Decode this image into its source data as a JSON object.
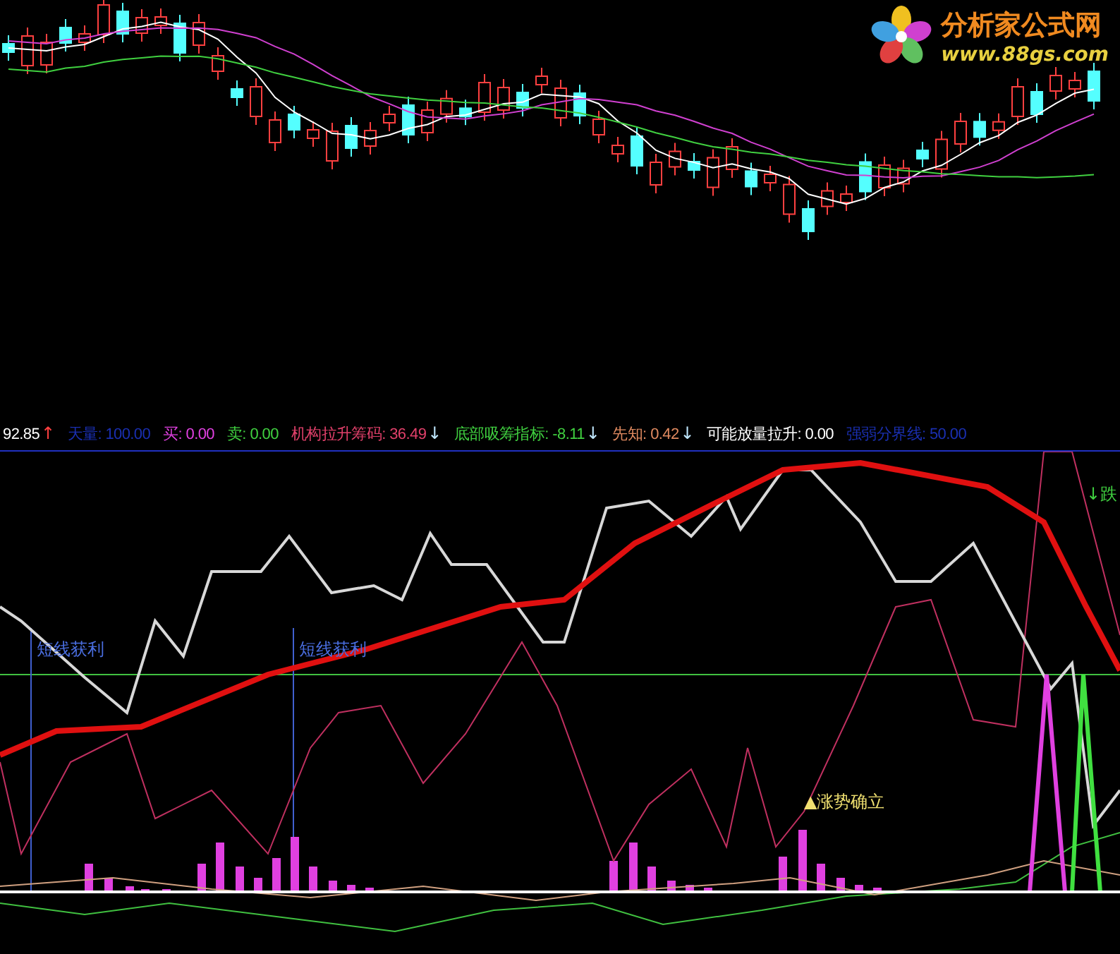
{
  "logo": {
    "name": "分析家公式网",
    "url": "www.88gs.com"
  },
  "indicator_bar": {
    "items": [
      {
        "text": "92.85",
        "arrow": "↑",
        "color": "#ffffff"
      },
      {
        "text": "天量: 100.00",
        "color": "#1a2fb0"
      },
      {
        "text": "买: 0.00",
        "color": "#e040e0"
      },
      {
        "text": "卖: 0.00",
        "color": "#40d040"
      },
      {
        "text": "机构拉升筹码: 36.49",
        "arrow": "↓",
        "color": "#e0406a"
      },
      {
        "text": "底部吸筹指标: -8.11",
        "arrow": "↓",
        "color": "#40d040"
      },
      {
        "text": "先知: 0.42",
        "arrow": "↓",
        "color": "#e08a60"
      },
      {
        "text": "可能放量拉升: 0.00",
        "color": "#ffffff"
      },
      {
        "text": "强弱分界线: 50.00",
        "color": "#1a2fb0"
      }
    ]
  },
  "signals": [
    {
      "kind": "profit",
      "text": "短线获利"
    },
    {
      "kind": "profit",
      "text": "短线获利"
    },
    {
      "kind": "rise",
      "text": "▲涨势确立"
    },
    {
      "kind": "fall",
      "text": "↓跌"
    }
  ]
}
